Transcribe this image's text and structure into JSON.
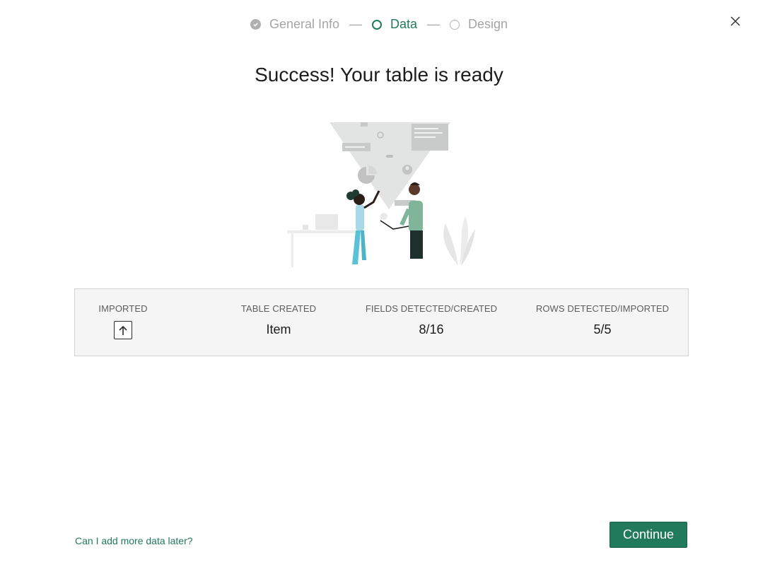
{
  "stepper": {
    "steps": [
      {
        "label": "General Info",
        "state": "done"
      },
      {
        "label": "Data",
        "state": "active"
      },
      {
        "label": "Design",
        "state": "todo"
      }
    ],
    "separator": "—"
  },
  "dialog": {
    "title": "Success! Your table is ready"
  },
  "summary": {
    "imported_label": "IMPORTED",
    "imported_icon": "upload-icon",
    "table_created_label": "TABLE CREATED",
    "table_created_value": "Item",
    "fields_label": "FIELDS DETECTED/CREATED",
    "fields_value": "8/16",
    "rows_label": "ROWS DETECTED/IMPORTED",
    "rows_value": "5/5"
  },
  "footer": {
    "help_link": "Can I add more data later?",
    "continue_label": "Continue"
  },
  "colors": {
    "accent": "#227a5c",
    "panel_bg": "#f4f5f4"
  }
}
